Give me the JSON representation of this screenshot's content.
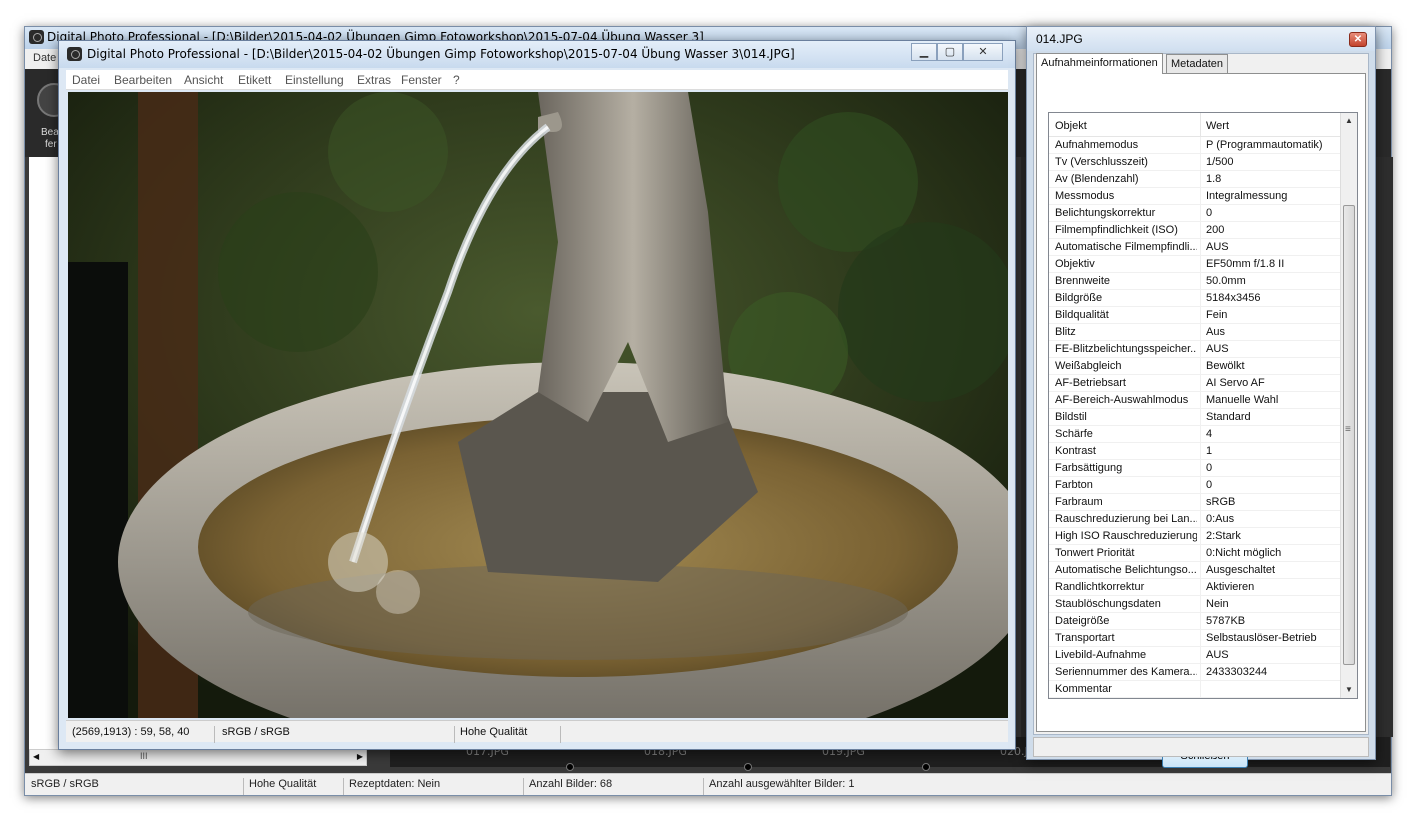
{
  "background_window": {
    "title": "Digital Photo Professional - [D:\\Bilder\\2015-04-02 Übungen  Gimp Fotoworkshop\\2015-07-04 Übung Wasser 3]",
    "menu_partial": "Date",
    "toolbar_partial_1": "Bea",
    "toolbar_partial_2": "fer",
    "filmstrip": [
      "017.JPG",
      "018.JPG",
      "019.JPG",
      "020.J"
    ],
    "scroll_grip": "III",
    "status": {
      "color": "sRGB / sRGB",
      "quality": "Hohe Qualität",
      "recipe": "Rezeptdaten: Nein",
      "count": "Anzahl Bilder: 68",
      "selected": "Anzahl ausgewählter Bilder: 1"
    }
  },
  "main_window": {
    "title": "Digital Photo Professional - [D:\\Bilder\\2015-04-02 Übungen  Gimp Fotoworkshop\\2015-07-04 Übung Wasser 3\\014.JPG]",
    "menu": [
      "Datei",
      "Bearbeiten",
      "Ansicht",
      "Etikett",
      "Einstellung",
      "Extras",
      "Fenster",
      "?"
    ],
    "status": {
      "pixel": "(2569,1913) : 59, 58, 40",
      "color": "sRGB / sRGB",
      "quality": "Hohe Qualität"
    }
  },
  "info_dialog": {
    "title": "014.JPG",
    "tabs": [
      "Aufnahmeinformationen",
      "Metadaten"
    ],
    "active_tab": "Aufnahmeinformationen",
    "header": {
      "key": "Objekt",
      "value": "Wert"
    },
    "rows": [
      {
        "k": "Aufnahmemodus",
        "v": "P (Programmautomatik)"
      },
      {
        "k": "Tv (Verschlusszeit)",
        "v": "1/500"
      },
      {
        "k": "Av (Blendenzahl)",
        "v": "1.8"
      },
      {
        "k": "Messmodus",
        "v": "Integralmessung"
      },
      {
        "k": "Belichtungskorrektur",
        "v": "0"
      },
      {
        "k": "Filmempfindlichkeit (ISO)",
        "v": "200"
      },
      {
        "k": "Automatische Filmempfindli...",
        "v": "AUS"
      },
      {
        "k": "Objektiv",
        "v": "EF50mm f/1.8 II"
      },
      {
        "k": "Brennweite",
        "v": "50.0mm"
      },
      {
        "k": "Bildgröße",
        "v": "5184x3456"
      },
      {
        "k": "Bildqualität",
        "v": "Fein"
      },
      {
        "k": "Blitz",
        "v": "Aus"
      },
      {
        "k": "FE-Blitzbelichtungsspeicher...",
        "v": "AUS"
      },
      {
        "k": "Weißabgleich",
        "v": "Bewölkt"
      },
      {
        "k": "AF-Betriebsart",
        "v": "AI Servo AF"
      },
      {
        "k": "AF-Bereich-Auswahlmodus",
        "v": "Manuelle  Wahl"
      },
      {
        "k": "Bildstil",
        "v": "Standard"
      },
      {
        "k": "Schärfe",
        "v": "4"
      },
      {
        "k": "Kontrast",
        "v": "1"
      },
      {
        "k": "Farbsättigung",
        "v": "0"
      },
      {
        "k": "Farbton",
        "v": "0"
      },
      {
        "k": "Farbraum",
        "v": "sRGB"
      },
      {
        "k": "Rauschreduzierung bei Lan...",
        "v": "0:Aus"
      },
      {
        "k": "High ISO Rauschreduzierung",
        "v": "2:Stark"
      },
      {
        "k": "Tonwert Priorität",
        "v": "0:Nicht möglich"
      },
      {
        "k": "Automatische Belichtungso...",
        "v": "Ausgeschaltet"
      },
      {
        "k": "Randlichtkorrektur",
        "v": "Aktivieren"
      },
      {
        "k": "Staublöschungsdaten",
        "v": "Nein"
      },
      {
        "k": "Dateigröße",
        "v": "5787KB"
      },
      {
        "k": "Transportart",
        "v": "Selbstauslöser-Betrieb"
      },
      {
        "k": "Livebild-Aufnahme",
        "v": "AUS"
      },
      {
        "k": "Seriennummer des Kamera...",
        "v": "2433303244"
      },
      {
        "k": "Kommentar",
        "v": ""
      }
    ],
    "close_button": "Schließen"
  }
}
